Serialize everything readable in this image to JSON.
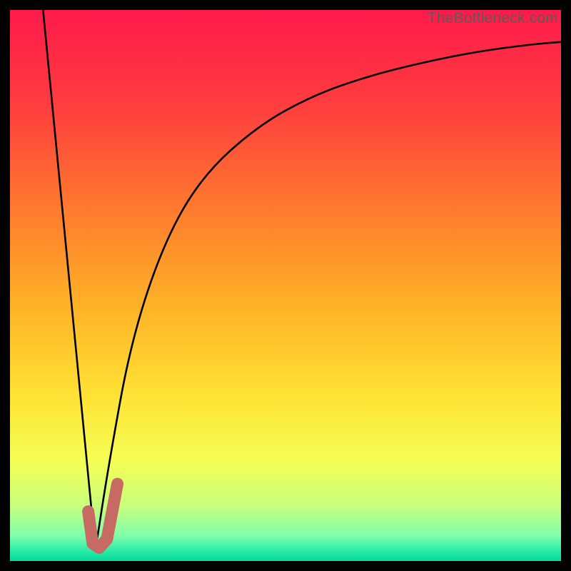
{
  "watermark": {
    "text": "TheBottleneck.com"
  },
  "colors": {
    "black": "#000000",
    "curve": "#000000",
    "marker": "#c76a64",
    "gradient_stops": [
      {
        "offset": 0.0,
        "color": "#ff1a4b"
      },
      {
        "offset": 0.18,
        "color": "#ff3f3e"
      },
      {
        "offset": 0.36,
        "color": "#ff7a2e"
      },
      {
        "offset": 0.54,
        "color": "#ffb327"
      },
      {
        "offset": 0.7,
        "color": "#ffe234"
      },
      {
        "offset": 0.82,
        "color": "#f4ff55"
      },
      {
        "offset": 0.9,
        "color": "#c8ff7c"
      },
      {
        "offset": 0.955,
        "color": "#7dffab"
      },
      {
        "offset": 0.985,
        "color": "#21e9a5"
      },
      {
        "offset": 1.0,
        "color": "#06d99c"
      }
    ]
  },
  "chart_data": {
    "type": "line",
    "title": "",
    "xlabel": "",
    "ylabel": "",
    "x_range": [
      0,
      100
    ],
    "y_range": [
      0,
      100
    ],
    "series": [
      {
        "name": "left-descent",
        "x": [
          6,
          15.5
        ],
        "y": [
          100,
          2
        ]
      },
      {
        "name": "right-curve",
        "x": [
          15.5,
          18,
          22,
          28,
          35,
          45,
          55,
          65,
          75,
          85,
          95,
          100
        ],
        "y": [
          2,
          18,
          40,
          58,
          70,
          79,
          84.5,
          88,
          90.5,
          92.5,
          93.8,
          94.2
        ]
      }
    ],
    "marker": {
      "name": "bottleneck-point",
      "path_xy": [
        [
          14.2,
          9.0
        ],
        [
          15.0,
          3.2
        ],
        [
          16.2,
          2.4
        ],
        [
          17.6,
          4.0
        ],
        [
          19.5,
          14.0
        ]
      ]
    }
  }
}
